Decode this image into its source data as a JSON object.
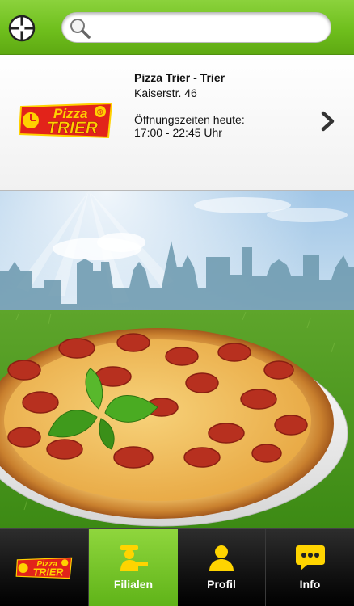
{
  "header": {
    "search": {
      "placeholder": "",
      "value": ""
    },
    "locate_icon": "crosshair-icon",
    "search_icon": "magnifier-icon"
  },
  "store": {
    "name": "Pizza Trier - Trier",
    "address": "Kaiserstr. 46",
    "hours_label": "Öffnungszeiten heute:",
    "hours_value": "17:00 - 22:45 Uhr",
    "logo_text_top": "Pizza",
    "logo_text_bottom": "TRIER",
    "logo_mark": "®"
  },
  "tabs": [
    {
      "label": "",
      "icon": "pizza-trier-logo",
      "active": false
    },
    {
      "label": "Filialen",
      "icon": "delivery-person-icon",
      "active": true
    },
    {
      "label": "Profil",
      "icon": "person-icon",
      "active": false
    },
    {
      "label": "Info",
      "icon": "speech-bubble-icon",
      "active": false
    }
  ],
  "colors": {
    "accent_green": "#6fbf1d",
    "logo_red": "#e2231a",
    "logo_yellow": "#ffd200",
    "icon_yellow": "#ffd400"
  }
}
